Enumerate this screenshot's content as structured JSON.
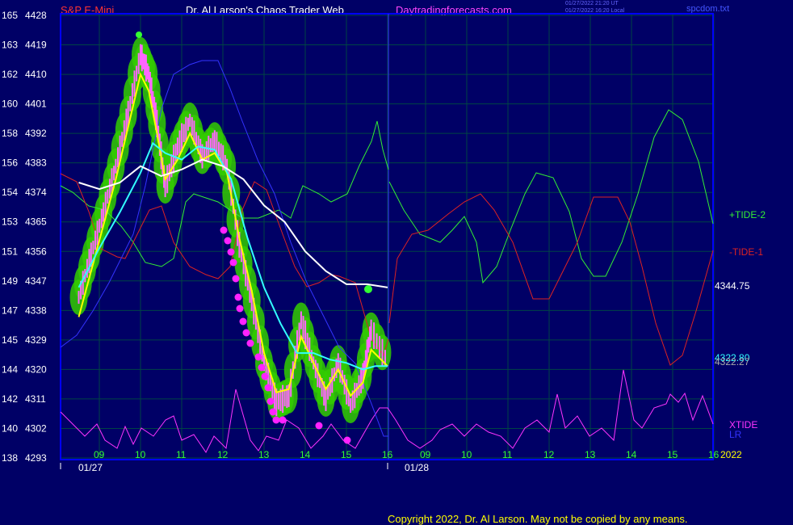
{
  "header": {
    "instrument": "S&P E-Mini",
    "title": "Dr. Al Larson's Chaos Trader Web",
    "site": "Daytradingforecasts.com",
    "time_ut": "01/27/2022 21:20 UT",
    "time_local": "01/27/2022 16:20 Local",
    "file": "spcdom.txt"
  },
  "copyright": "Copyright 2022, Dr. Al Larson. May not be copied by any means.",
  "colors": {
    "background": "#000066",
    "grid": "#004444",
    "frame": "#0000ff",
    "price_bars": "#ff66ff",
    "green_glow": "#33cc00",
    "yellow_avg": "#ffff00",
    "cyan_avg": "#33ffff",
    "white_avg": "#ffffff",
    "tide_plus": "#33ee33",
    "tide_minus": "#dd2222",
    "xtide": "#ff33ff",
    "lr": "#3333ff"
  },
  "chart_data": {
    "type": "line",
    "y_axis_left": {
      "labels_outer": [
        "165",
        "163",
        "162",
        "160",
        "158",
        "156",
        "154",
        "153",
        "151",
        "149",
        "147",
        "145",
        "144",
        "142",
        "140",
        "138"
      ],
      "labels_inner": [
        "4428",
        "4419",
        "4410",
        "4401",
        "4392",
        "4383",
        "4374",
        "4365",
        "4356",
        "4347",
        "4338",
        "4329",
        "4320",
        "4311",
        "4302",
        "4293"
      ],
      "range": [
        4293,
        4428
      ]
    },
    "x_axis": {
      "hour_ticks": [
        "09",
        "10",
        "11",
        "12",
        "13",
        "14",
        "15",
        "16",
        "09",
        "10",
        "11",
        "12",
        "13",
        "14",
        "15",
        "16"
      ],
      "dates": [
        "01/27",
        "01/28"
      ],
      "year": "2022"
    },
    "right_labels": {
      "tide2": "+TIDE-2",
      "tide1": "-TIDE-1",
      "white_value": "4344.75",
      "value_a": "4322.80",
      "value_b": "4322.27",
      "xtide": "XTIDE",
      "lr": "LR"
    },
    "series": [
      {
        "name": "price",
        "unit": "index",
        "x": [
          8.5,
          8.8,
          9.1,
          9.4,
          9.7,
          10.0,
          10.2,
          10.4,
          10.6,
          10.9,
          11.2,
          11.5,
          11.8,
          12.1,
          12.4,
          12.7,
          13.0,
          13.3,
          13.6,
          13.9,
          14.2,
          14.5,
          14.8,
          15.1,
          15.4,
          15.6,
          16.0
        ],
        "values": [
          4342,
          4355,
          4368,
          4382,
          4398,
          4416,
          4410,
          4395,
          4376,
          4388,
          4396,
          4385,
          4390,
          4382,
          4358,
          4341,
          4322,
          4310,
          4312,
          4335,
          4322,
          4311,
          4322,
          4309,
          4318,
          4332,
          4322
        ]
      },
      {
        "name": "yellow-average",
        "unit": "index",
        "x": [
          8.5,
          8.8,
          9.1,
          9.4,
          9.7,
          10.0,
          10.2,
          10.4,
          10.6,
          10.9,
          11.2,
          11.5,
          11.8,
          12.1,
          12.4,
          12.7,
          13.0,
          13.3,
          13.6,
          13.9,
          14.2,
          14.5,
          14.8,
          15.1,
          15.4,
          15.6,
          16.0
        ],
        "values": [
          4336,
          4350,
          4364,
          4378,
          4394,
          4410,
          4405,
          4392,
          4378,
          4384,
          4392,
          4384,
          4386,
          4380,
          4360,
          4344,
          4325,
          4313,
          4314,
          4330,
          4322,
          4314,
          4320,
          4312,
          4316,
          4326,
          4321
        ]
      },
      {
        "name": "cyan-average",
        "unit": "index",
        "x": [
          8.5,
          9.0,
          9.5,
          10.0,
          10.3,
          10.6,
          11.0,
          11.4,
          11.8,
          12.2,
          12.6,
          13.0,
          13.4,
          13.8,
          14.2,
          14.6,
          15.0,
          15.4,
          15.7,
          16.0
        ],
        "values": [
          4345,
          4357,
          4368,
          4380,
          4389,
          4386,
          4384,
          4388,
          4387,
          4378,
          4360,
          4345,
          4334,
          4325,
          4325,
          4323,
          4322,
          4320,
          4321,
          4321
        ]
      },
      {
        "name": "white-average",
        "unit": "index",
        "x": [
          8.5,
          9.0,
          9.5,
          10.0,
          10.5,
          11.0,
          11.5,
          12.0,
          12.5,
          13.0,
          13.5,
          14.0,
          14.5,
          15.0,
          15.5,
          16.0
        ],
        "values": [
          4377,
          4375,
          4377,
          4382,
          4379,
          4381,
          4384,
          4382,
          4378,
          4370,
          4365,
          4356,
          4350,
          4346,
          4346,
          4345
        ]
      }
    ]
  }
}
